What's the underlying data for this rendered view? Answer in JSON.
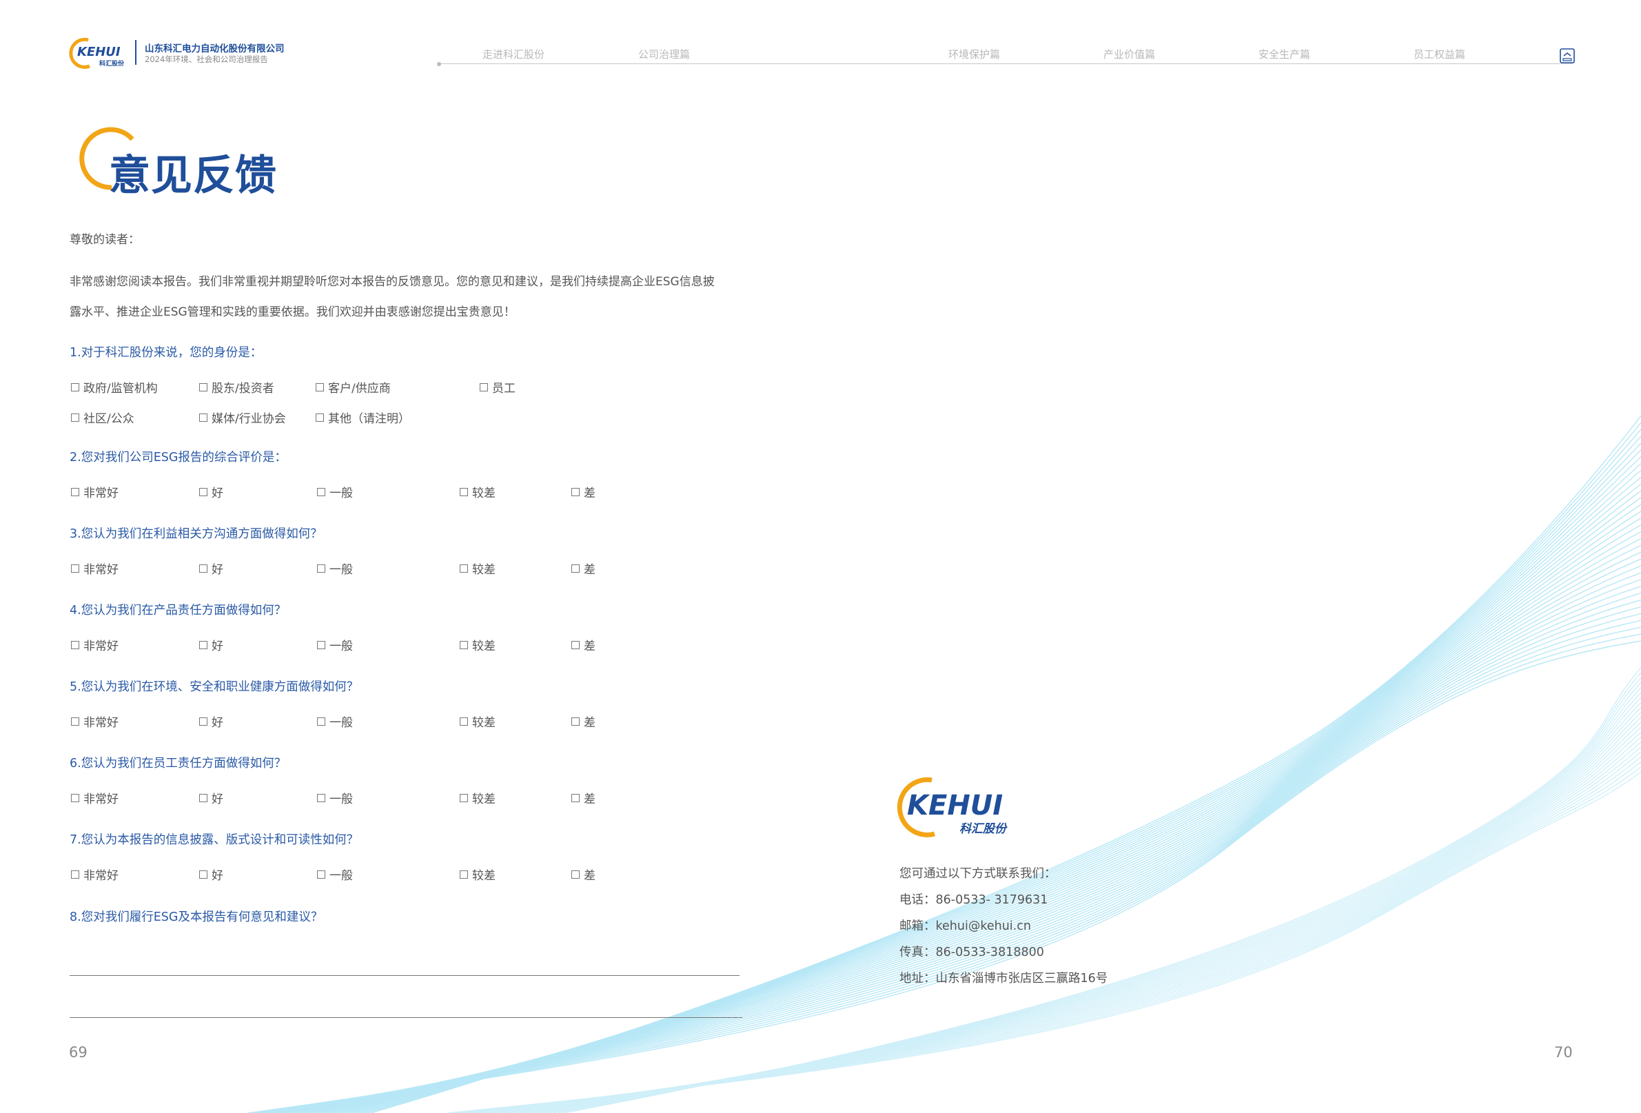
{
  "header": {
    "company_name": "山东科汇电力自动化股份有限公司",
    "report_subtitle": "2024年环境、社会和公司治理报告",
    "logo_text": "KEHUI",
    "logo_sub": "科汇股份",
    "nav": [
      "走进科汇股份",
      "公司治理篇",
      "环境保护篇",
      "产业价值篇",
      "安全生产篇",
      "员工权益篇"
    ]
  },
  "page_title": "意见反馈",
  "greeting": "尊敬的读者：",
  "intro_line1": "非常感谢您阅读本报告。我们非常重视并期望聆听您对本报告的反馈意见。您的意见和建议，是我们持续提高企业ESG信息披",
  "intro_line2": "露水平、推进企业ESG管理和实践的重要依据。我们欢迎并由衷感谢您提出宝贵意见！",
  "q1": {
    "question": "1.对于科汇股份来说，您的身份是：",
    "row1": [
      "政府/监管机构",
      "股东/投资者",
      "客户/供应商",
      "员工"
    ],
    "row2": [
      "社区/公众",
      "媒体/行业协会",
      "其他（请注明）"
    ]
  },
  "rating_options": [
    "非常好",
    "好",
    "一般",
    "较差",
    "差"
  ],
  "questions": [
    "2.您对我们公司ESG报告的综合评价是：",
    "3.您认为我们在利益相关方沟通方面做得如何？",
    "4.您认为我们在产品责任方面做得如何？",
    "5.您认为我们在环境、安全和职业健康方面做得如何？",
    "6.您认为我们在员工责任方面做得如何？",
    "7.您认为本报告的信息披露、版式设计和可读性如何？"
  ],
  "q8": "8.您对我们履行ESG及本报告有何意见和建议？",
  "contact": {
    "logo_text": "KEHUI",
    "logo_sub": "科汇股份",
    "intro": "您可通过以下方式联系我们：",
    "phone": "电话：86-0533- 3179631",
    "email": "邮箱：kehui@kehui.cn",
    "fax": "传真：86-0533-3818800",
    "address": "地址：山东省淄博市张店区三赢路16号"
  },
  "page_left": "69",
  "page_right": "70",
  "colors": {
    "brand_blue": "#1f4e9a",
    "accent_orange": "#f2a516",
    "wave_cyan": "#8fdcf2"
  }
}
